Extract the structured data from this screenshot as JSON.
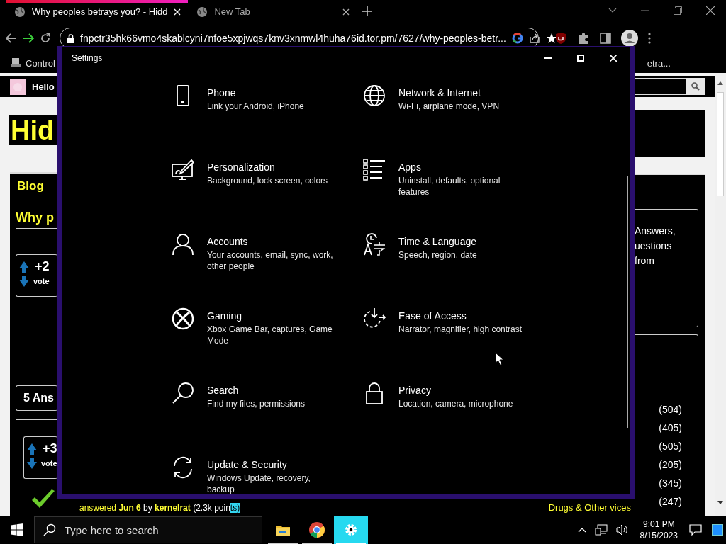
{
  "browser": {
    "tabs": [
      {
        "title": "Why peoples betrays you? - Hidd",
        "selected": true
      },
      {
        "title": "New Tab",
        "selected": false
      }
    ],
    "address": "fnpctr35hk66vmo4skablcyni7nfoe5xpjwqs7knv3xnmwl4huha76id.tor.pm/7627/why-peoples-betr...",
    "bookmarks": [
      "Control",
      "etra..."
    ]
  },
  "page": {
    "greeting": "Hello",
    "site_title": "Hid",
    "nav": [
      "Blog"
    ],
    "question_title": "Why p",
    "question_votes": {
      "count": "+2",
      "label": "vote"
    },
    "answers_heading": "5 Ans",
    "answer_votes": {
      "count": "+3",
      "label": "vote"
    },
    "answer_meta": {
      "verb": "answered",
      "date": "Jun 6",
      "by": "by",
      "user": "kernelrat",
      "points": "(2.3k poin",
      "points_selected": "ts)"
    },
    "side_text": [
      "Answers,",
      "uestions",
      "from"
    ],
    "categories": [
      {
        "count": "(504)"
      },
      {
        "count": "(405)"
      },
      {
        "count": "(505)"
      },
      {
        "count": "(205)"
      },
      {
        "count": "(345)"
      },
      {
        "name": "Drugs & Other vices",
        "count": "(247)"
      }
    ]
  },
  "settings": {
    "title": "Settings",
    "items": [
      {
        "kind": "phone",
        "title": "Phone",
        "desc": "Link your Android, iPhone"
      },
      {
        "kind": "network",
        "title": "Network & Internet",
        "desc": "Wi-Fi, airplane mode, VPN"
      },
      {
        "kind": "personalization",
        "title": "Personalization",
        "desc": "Background, lock screen, colors"
      },
      {
        "kind": "apps",
        "title": "Apps",
        "desc": "Uninstall, defaults, optional features"
      },
      {
        "kind": "accounts",
        "title": "Accounts",
        "desc": "Your accounts, email, sync, work, other people"
      },
      {
        "kind": "time",
        "title": "Time & Language",
        "desc": "Speech, region, date"
      },
      {
        "kind": "gaming",
        "title": "Gaming",
        "desc": "Xbox Game Bar, captures, Game Mode"
      },
      {
        "kind": "ease",
        "title": "Ease of Access",
        "desc": "Narrator, magnifier, high contrast"
      },
      {
        "kind": "search",
        "title": "Search",
        "desc": "Find my files, permissions"
      },
      {
        "kind": "privacy",
        "title": "Privacy",
        "desc": "Location, camera, microphone"
      },
      {
        "kind": "update",
        "title": "Update & Security",
        "desc": "Windows Update, recovery, backup"
      }
    ]
  },
  "taskbar": {
    "search_placeholder": "Type here to search",
    "apps": [
      {
        "kind": "explorer",
        "active": false
      },
      {
        "kind": "chrome",
        "active": false
      },
      {
        "kind": "settings",
        "active": true
      }
    ],
    "time": "9:01 PM",
    "date": "8/15/2023"
  }
}
